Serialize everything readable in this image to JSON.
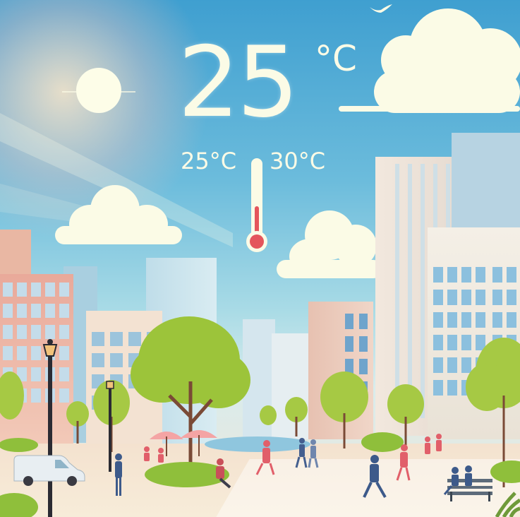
{
  "weather": {
    "current_temp": "25",
    "current_unit": "°C",
    "low_temp": "25°C",
    "high_temp": "30°C"
  },
  "icons": [
    "sun-icon",
    "thermometer-icon",
    "bird-icon",
    "street-lamp-icon",
    "umbrella-icon",
    "bench-icon",
    "car-icon"
  ],
  "colors": {
    "sky_top": "#3f9fd0",
    "sky_bottom": "#d9ecec",
    "text": "#fbfbe6",
    "thermometer_bulb": "#e4555c",
    "foliage": "#9cc43a"
  }
}
